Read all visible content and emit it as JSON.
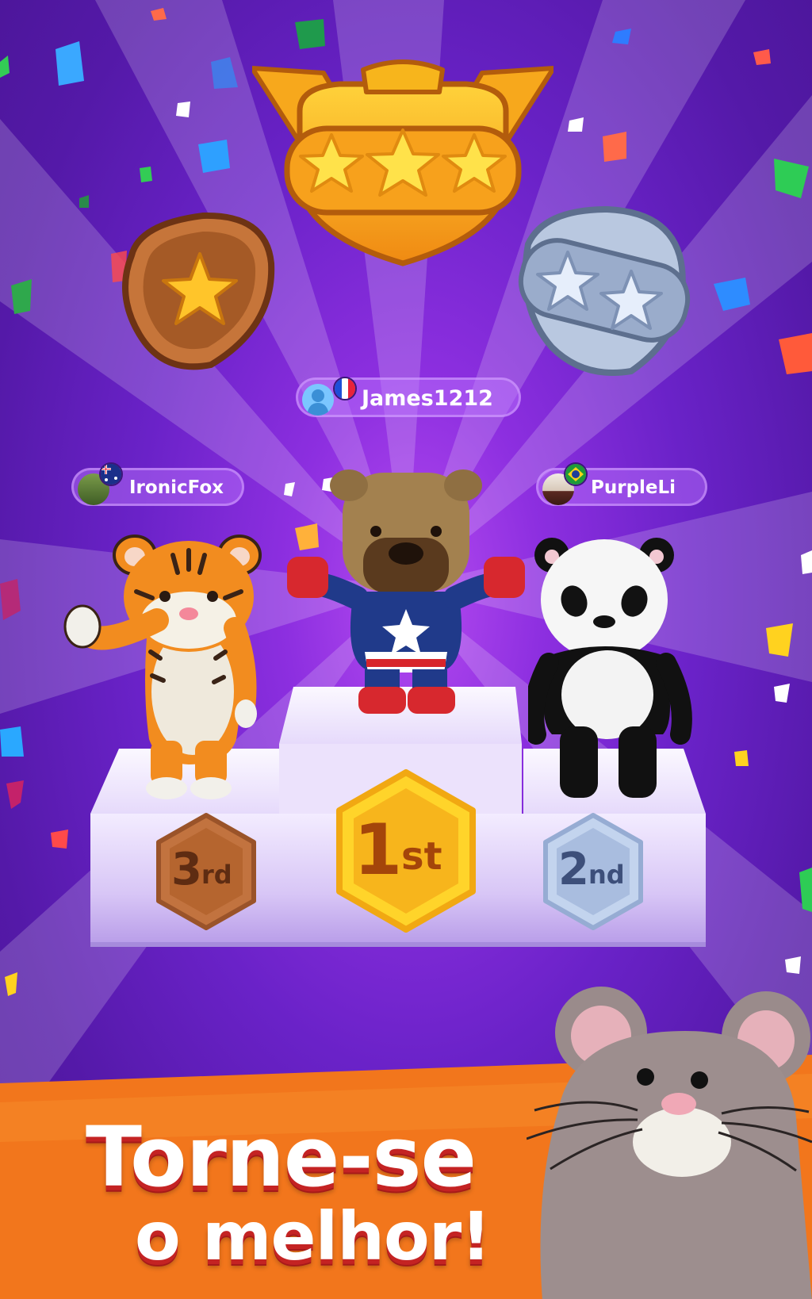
{
  "podium": {
    "first": {
      "player": "James1212",
      "rank_number": "1",
      "rank_suffix": "st",
      "flag": "france",
      "character": "bear-superhero"
    },
    "second": {
      "player": "PurpleLi",
      "rank_number": "2",
      "rank_suffix": "nd",
      "flag": "brazil",
      "character": "panda"
    },
    "third": {
      "player": "IronicFox",
      "rank_number": "3",
      "rank_suffix": "rd",
      "flag": "australia",
      "character": "tiger"
    }
  },
  "badges": {
    "gold": {
      "stars": 3,
      "icon": "gold-trophy-badge-icon"
    },
    "silver": {
      "stars": 2,
      "icon": "silver-badge-icon"
    },
    "bronze": {
      "stars": 1,
      "icon": "bronze-badge-icon"
    }
  },
  "banner": {
    "line1": "Torne-se",
    "line2": "o melhor!",
    "mascot": "mouse"
  },
  "colors": {
    "background": "#6a22c8",
    "banner": "#f2761c",
    "gold": "#f7b51c",
    "silver": "#9fb4d6",
    "bronze": "#b86a36"
  }
}
